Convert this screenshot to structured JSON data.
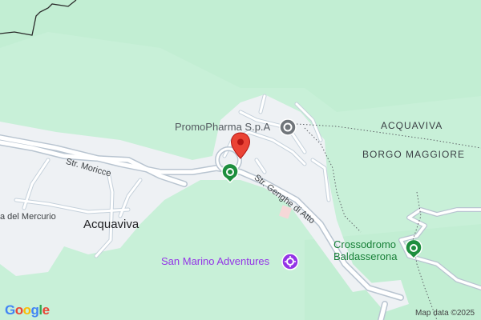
{
  "map": {
    "colors": {
      "land": "#c8f0d8",
      "forest": "#b9ebcc",
      "urban": "#eef1f4",
      "road": "#ffffff",
      "road_outline": "#b8c4d0",
      "border": "#2b2b2b",
      "marker": "#ea4335",
      "poi_green": "#1e8e3e",
      "poi_purple": "#9334e6",
      "poi_gray": "#70757a"
    },
    "area_labels": [
      "ACQUAVIVA",
      "BORGO MAGGIORE"
    ],
    "town_label": "Acquaviva",
    "streets": {
      "moricce": "Str. Moricce",
      "genghe": "Str. Genghe di Atto",
      "mercurio": "a del Mercurio"
    },
    "pois": {
      "promopharma": {
        "label": "PromoPharma S.p.A",
        "icon": "business-icon"
      },
      "adventures": {
        "label": "San Marino Adventures",
        "icon": "attraction-icon"
      },
      "crossodromo": {
        "label_line1": "Crossodromo",
        "label_line2": "Baldasserona",
        "icon": "park-icon"
      },
      "unnamed_park": {
        "icon": "park-icon"
      }
    },
    "selected_marker": {
      "icon": "red-pin-icon"
    },
    "footer": {
      "logo": "Google",
      "attribution": "Map data ©2025"
    }
  }
}
